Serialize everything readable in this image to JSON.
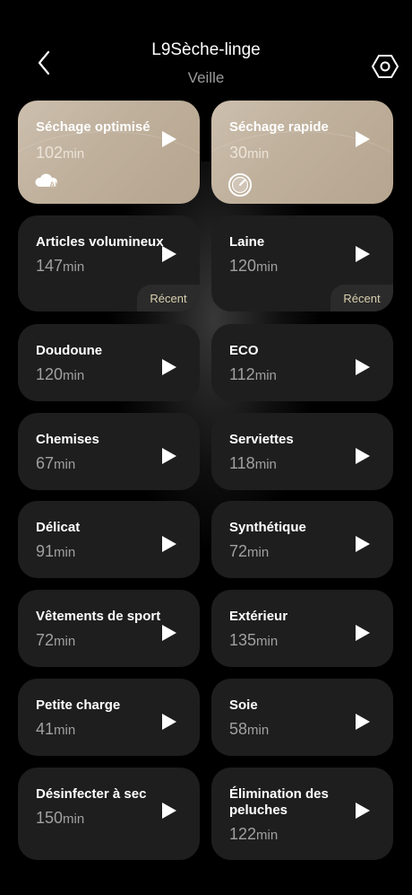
{
  "header": {
    "title": "L9Sèche-linge",
    "status": "Veille"
  },
  "unit": "min",
  "featured": [
    {
      "name": "Séchage optimisé",
      "duration": "102",
      "badge": "ai-cloud-icon"
    },
    {
      "name": "Séchage rapide",
      "duration": "30",
      "badge": "timer-icon"
    }
  ],
  "programs": [
    {
      "name": "Articles volumineux",
      "duration": "147",
      "tag": "Récent"
    },
    {
      "name": "Laine",
      "duration": "120",
      "tag": "Récent"
    },
    {
      "name": "Doudoune",
      "duration": "120"
    },
    {
      "name": "ECO",
      "duration": "112"
    },
    {
      "name": "Chemises",
      "duration": "67"
    },
    {
      "name": "Serviettes",
      "duration": "118"
    },
    {
      "name": "Délicat",
      "duration": "91"
    },
    {
      "name": "Synthétique",
      "duration": "72"
    },
    {
      "name": "Vêtements de sport",
      "duration": "72"
    },
    {
      "name": "Extérieur",
      "duration": "135"
    },
    {
      "name": "Petite charge",
      "duration": "41"
    },
    {
      "name": "Soie",
      "duration": "58"
    },
    {
      "name": "Désinfecter à sec",
      "duration": "150"
    },
    {
      "name": "Élimination des peluches",
      "duration": "122"
    }
  ]
}
